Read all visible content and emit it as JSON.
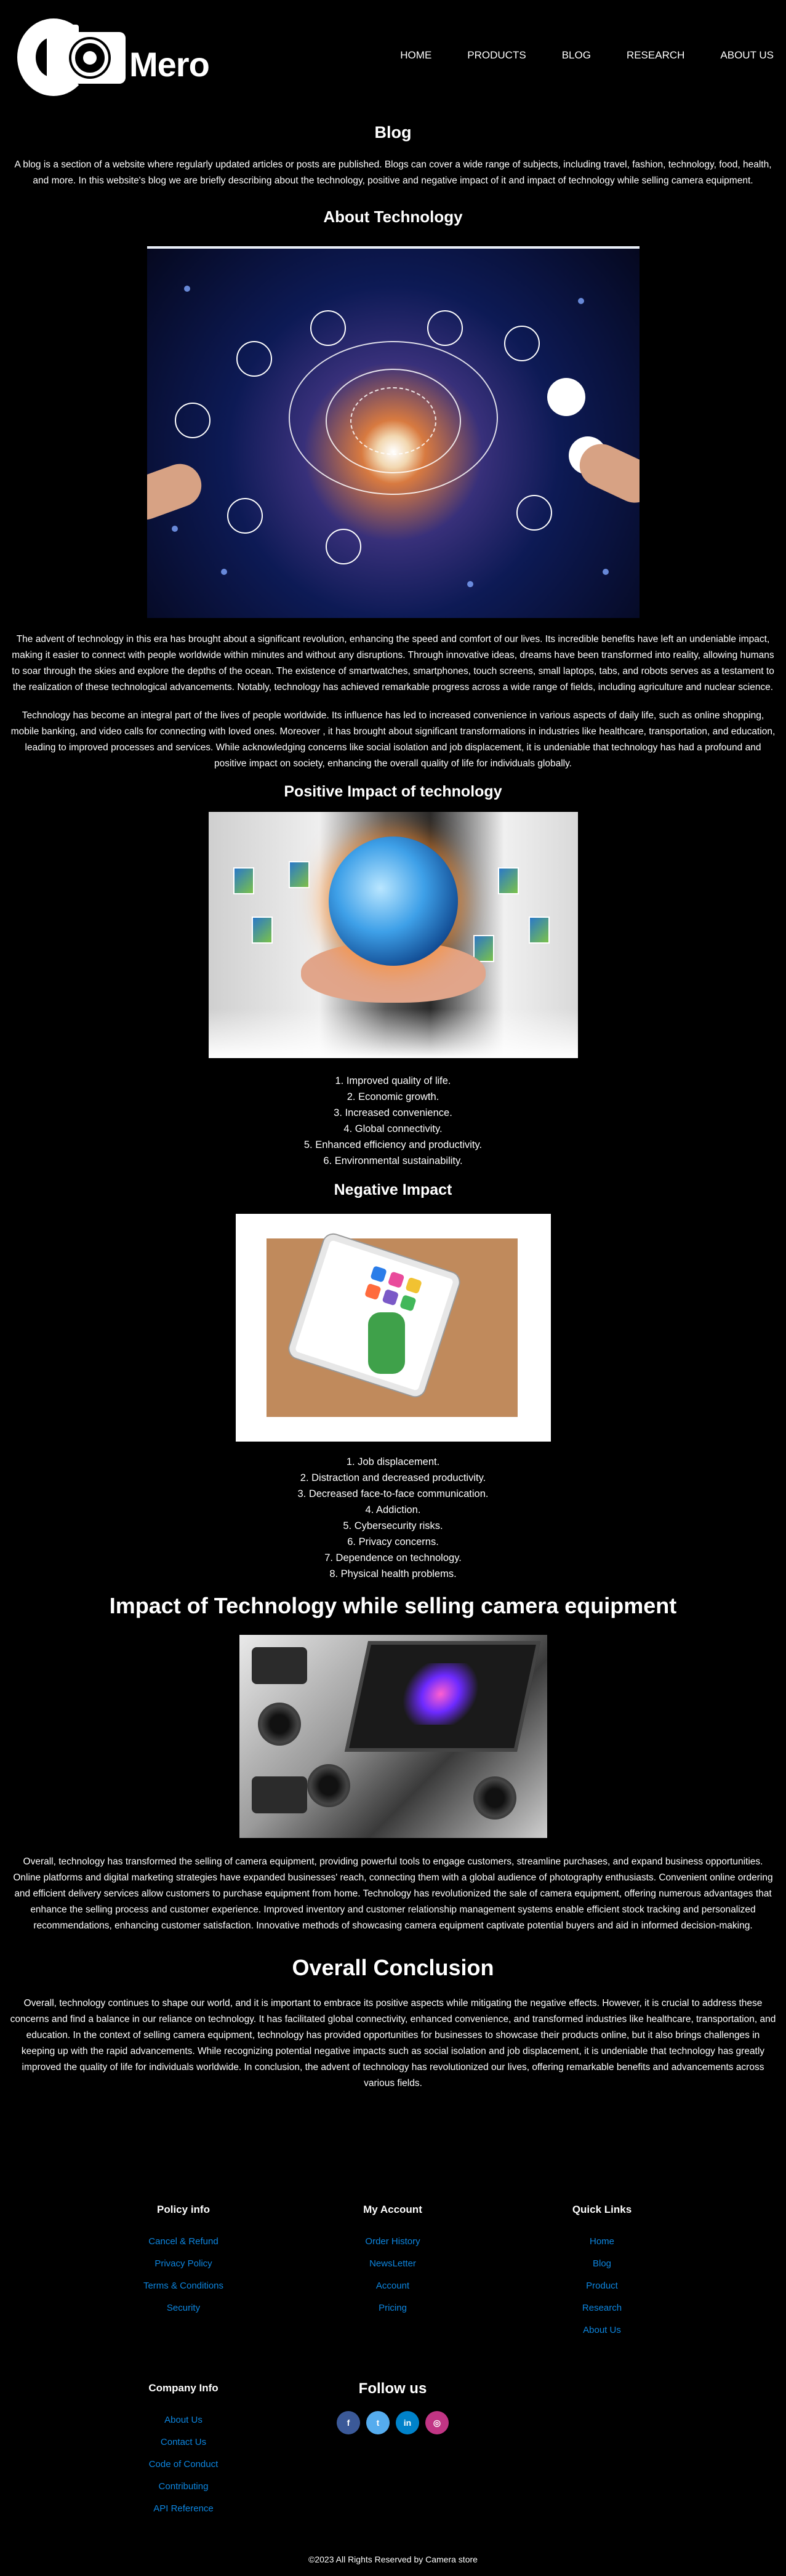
{
  "brand": {
    "name": "Mero"
  },
  "nav": {
    "items": [
      "HOME",
      "PRODUCTS",
      "BLOG",
      "RESEARCH",
      "ABOUT US"
    ]
  },
  "blog": {
    "title": "Blog",
    "intro": "A blog is a section of a website where regularly updated articles or posts are published. Blogs can cover a wide range of subjects, including travel, fashion, technology, food, health, and more. In this website's blog we are briefly describing about the technology, positive and negative impact of it and impact of technology while selling camera equipment."
  },
  "about": {
    "heading": "About Technology",
    "para1": "The advent of technology in this era has brought about a significant revolution, enhancing the speed and comfort of our lives. Its incredible benefits have left an undeniable impact, making it easier to connect with people worldwide within minutes and without any disruptions. Through innovative ideas, dreams have been transformed into reality, allowing humans to soar through the skies and explore the depths of the ocean. The existence of smartwatches, smartphones, touch screens, small laptops, tabs, and robots serves as a testament to the realization of these technological advancements. Notably, technology has achieved remarkable progress across a wide range of fields, including agriculture and nuclear science.",
    "para2": "Technology has become an integral part of the lives of people worldwide. Its influence has led to increased convenience in various aspects of daily life, such as online shopping, mobile banking, and video calls for connecting with loved ones. Moreover , it has brought about significant transformations in industries like healthcare, transportation, and education, leading to improved processes and services. While acknowledging concerns like social isolation and job displacement, it is undeniable that technology has had a profound and positive impact on society, enhancing the overall quality of life for individuals globally."
  },
  "positive": {
    "heading": "Positive Impact of technology",
    "items": [
      "1. Improved quality of life.",
      "2. Economic growth.",
      "3. Increased convenience.",
      "4. Global connectivity.",
      "5. Enhanced efficiency and productivity.",
      "6. Environmental sustainability."
    ]
  },
  "negative": {
    "heading": "Negative Impact",
    "items": [
      "1. Job displacement.",
      "2. Distraction and decreased productivity.",
      "3. Decreased face-to-face communication.",
      "4. Addiction.",
      "5. Cybersecurity risks.",
      "6. Privacy concerns.",
      "7. Dependence on technology.",
      "8. Physical health problems."
    ]
  },
  "selling": {
    "heading": "Impact of Technology while selling camera equipment",
    "para": "Overall, technology has transformed the selling of camera equipment, providing powerful tools to engage customers, streamline purchases, and expand business opportunities. Online platforms and digital marketing strategies have expanded businesses' reach, connecting them with a global audience of photography enthusiasts. Convenient online ordering and efficient delivery services allow customers to purchase equipment from home. Technology has revolutionized the sale of camera equipment, offering numerous advantages that enhance the selling process and customer experience. Improved inventory and customer relationship management systems enable efficient stock tracking and personalized recommendations, enhancing customer satisfaction. Innovative methods of showcasing camera equipment captivate potential buyers and aid in informed decision-making."
  },
  "conclusion": {
    "heading": "Overall Conclusion",
    "para": "Overall, technology continues to shape our world, and it is important to embrace its positive aspects while mitigating the negative effects. However, it is crucial to address these concerns and find a balance in our reliance on technology. It has facilitated global connectivity, enhanced convenience, and transformed industries like healthcare, transportation, and education. In the context of selling camera equipment, technology has provided opportunities for businesses to showcase their products online, but it also brings challenges in keeping up with the rapid advancements. While recognizing potential negative impacts such as social isolation and job displacement, it is undeniable that technology has greatly improved the quality of life for individuals worldwide. In conclusion, the advent of technology has revolutionized our lives, offering remarkable benefits and advancements across various fields."
  },
  "footer": {
    "policy": {
      "title": "Policy info",
      "links": [
        "Cancel & Refund",
        "Privacy Policy",
        "Terms & Conditions",
        "Security"
      ]
    },
    "account": {
      "title": "My Account",
      "links": [
        "Order History",
        "NewsLetter",
        "Account",
        "Pricing"
      ]
    },
    "quick": {
      "title": "Quick Links",
      "links": [
        "Home",
        "Blog",
        "Product",
        "Research",
        "About Us"
      ]
    },
    "company": {
      "title": "Company Info",
      "links": [
        "About Us",
        "Contact Us",
        "Code of Conduct",
        "Contributing",
        "API Reference"
      ]
    },
    "follow": {
      "title": "Follow us",
      "icons": [
        "facebook-icon",
        "twitter-icon",
        "linkedin-icon",
        "instagram-icon"
      ],
      "colors": [
        "#3b5998",
        "#55acee",
        "#0082ca",
        "#c13584"
      ]
    },
    "copyright": "©2023 All Rights Reserved by Camera store"
  },
  "colors": {
    "background": "#000000",
    "link": "#0d86e0",
    "text": "#ffffff"
  }
}
